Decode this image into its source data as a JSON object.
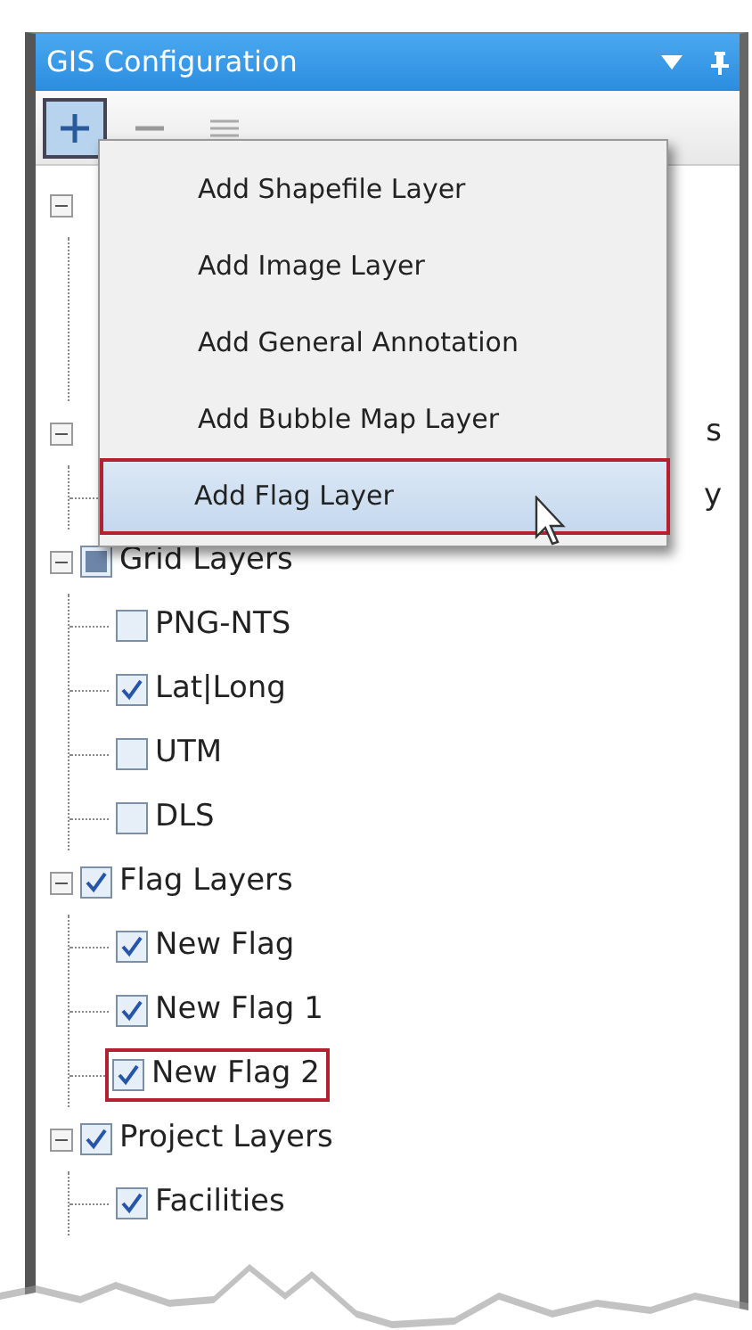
{
  "panel": {
    "title": "GIS Configuration"
  },
  "toolbar": [
    {
      "kind": "add",
      "selected": true
    },
    {
      "kind": "remove",
      "selected": false
    },
    {
      "kind": "layers",
      "selected": false
    }
  ],
  "menu": {
    "items": [
      {
        "label": "Add Shapefile Layer",
        "selected": false
      },
      {
        "label": "Add Image Layer",
        "selected": false
      },
      {
        "label": "Add General Annotation",
        "selected": false
      },
      {
        "label": "Add Bubble Map Layer",
        "selected": false
      },
      {
        "label": "Add Flag Layer",
        "selected": true
      }
    ]
  },
  "tree": [
    {
      "expanded": true
    },
    {
      "text": "s",
      "expanded": true,
      "children": [
        {
          "text": "y"
        }
      ]
    },
    {
      "text": "Grid Layers",
      "expanded": true,
      "checked": false,
      "partial": true,
      "children": [
        {
          "text": "PNG-NTS",
          "checked": false
        },
        {
          "text": "Lat|Long",
          "checked": true
        },
        {
          "text": "UTM",
          "checked": false
        },
        {
          "text": "DLS",
          "checked": false
        }
      ]
    },
    {
      "text": "Flag Layers",
      "expanded": true,
      "checked": true,
      "children": [
        {
          "text": "New Flag",
          "checked": true,
          "highlighted": false
        },
        {
          "text": "New Flag 1",
          "checked": true,
          "highlighted": false
        },
        {
          "text": "New Flag 2",
          "checked": true,
          "highlighted": true
        }
      ]
    },
    {
      "text": "Project Layers",
      "expanded": true,
      "checked": true,
      "children": [
        {
          "text": "Facilities",
          "checked": true
        }
      ]
    }
  ]
}
